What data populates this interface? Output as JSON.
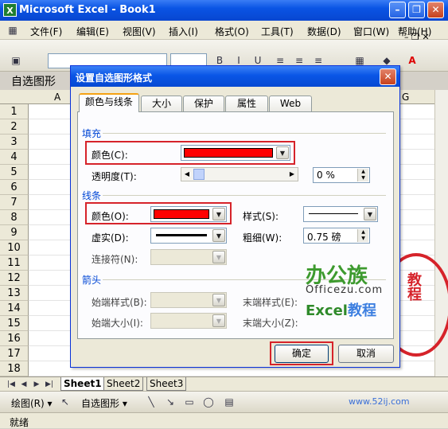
{
  "window": {
    "title": "Microsoft Excel - Book1",
    "minimize_glyph": "–",
    "restore_glyph": "❐",
    "close_glyph": "✕"
  },
  "menubar": {
    "items": [
      "文件(F)",
      "编辑(E)",
      "视图(V)",
      "插入(I)",
      "格式(O)",
      "工具(T)",
      "数据(D)",
      "窗口(W)",
      "帮助(H)"
    ],
    "doc_controls": "– ❐ ✕"
  },
  "formula_bar": {
    "name_box": "自选图形"
  },
  "grid": {
    "columns": [
      "A",
      "G"
    ],
    "rows": [
      "1",
      "2",
      "3",
      "4",
      "5",
      "6",
      "7",
      "8",
      "9",
      "10",
      "11",
      "12",
      "13",
      "14",
      "15",
      "16",
      "17",
      "18"
    ]
  },
  "sheet_tabs": [
    "Sheet1",
    "Sheet2",
    "Sheet3"
  ],
  "draw_toolbar": {
    "draw_label": "绘图(R) ▾",
    "autoshape_label": "自选图形 ▾"
  },
  "status_bar": {
    "text": "就绪"
  },
  "watermark": {
    "seal_text": "教程",
    "site": "www.52ij.com"
  },
  "logo": {
    "line1": "办公族",
    "line2": "Officezu.com",
    "line3_a": "Excel",
    "line3_b": "教程"
  },
  "dialog": {
    "title": "设置自选图形格式",
    "close": "✕",
    "tabs": [
      "颜色与线条",
      "大小",
      "保护",
      "属性",
      "Web"
    ],
    "active_tab": 0,
    "fill": {
      "section": "填充",
      "color_label": "颜色(C):",
      "color_value": "#ff0000",
      "transparency_label": "透明度(T):",
      "transparency_value": "0 %",
      "transparency_level": 0
    },
    "line": {
      "section": "线条",
      "color_label": "颜色(O):",
      "color_value": "#ff0000",
      "style_label": "样式(S):",
      "dash_label": "虚实(D):",
      "weight_label": "粗细(W):",
      "weight_value": "0.75 磅",
      "connector_label": "连接符(N):"
    },
    "arrows": {
      "section": "箭头",
      "begin_style_label": "始端样式(B):",
      "end_style_label": "末端样式(E):",
      "begin_size_label": "始端大小(I):",
      "end_size_label": "末端大小(Z):"
    },
    "ok": "确定",
    "cancel": "取消"
  },
  "colors": {
    "highlight": "#d6232a",
    "title_bar": "#0a54e4"
  }
}
